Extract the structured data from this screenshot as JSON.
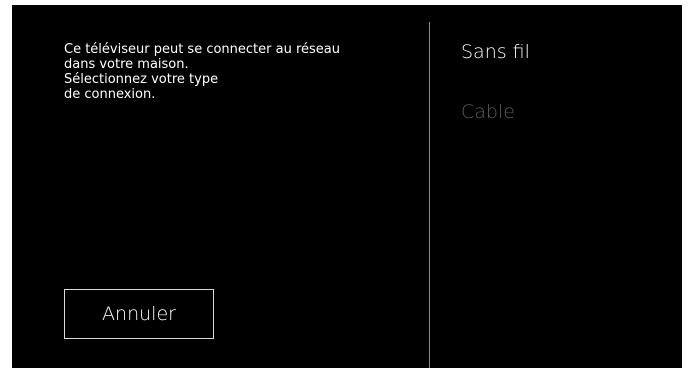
{
  "dialog": {
    "message_lines": [
      "Ce téléviseur peut se connecter au réseau",
      "dans votre maison.",
      "Sélectionnez votre type",
      "de connexion."
    ],
    "cancel_label": "Annuler"
  },
  "connection_options": [
    {
      "label": "Sans fil",
      "state": "selected"
    },
    {
      "label": "Cable",
      "state": "disabled"
    }
  ],
  "colors": {
    "background": "#000000",
    "text": "#ffffff",
    "disabled_text": "#5c5c5c",
    "divider": "#8a8a8a",
    "button_border": "#d9d9d9"
  }
}
